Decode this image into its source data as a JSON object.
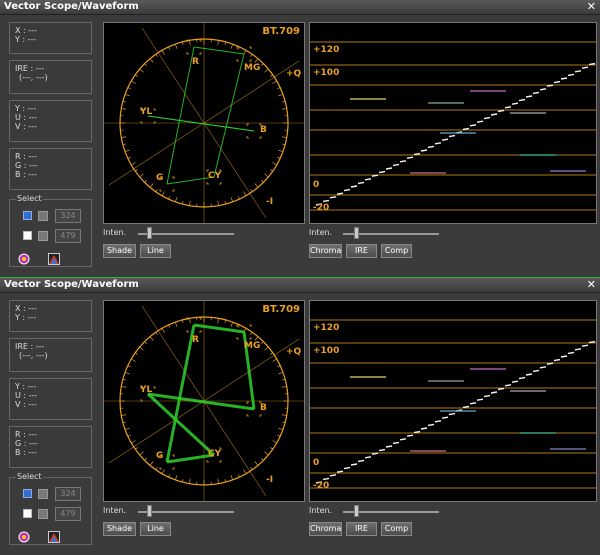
{
  "windows": [
    {
      "title": "Vector Scope/Waveform",
      "close_label": "✕",
      "info": {
        "xy": [
          "X : ---",
          "Y : ---"
        ],
        "ire": [
          "IRE : ---",
          "(---, ---)"
        ],
        "yuv": [
          "Y : ---",
          "U : ---",
          "V : ---"
        ],
        "rgb": [
          "R : ---",
          "G : ---",
          "B : ---"
        ]
      },
      "select": {
        "label": "Select",
        "row1_value": "324",
        "row2_value": "479"
      },
      "vectorscope": {
        "standard": "BT.709",
        "targets": {
          "R": "R",
          "MG": "MG",
          "Q": "+Q",
          "YL": "YL",
          "B": "B",
          "G": "G",
          "CY": "CY",
          "I": "-I"
        }
      },
      "waveform": {
        "labels": [
          "+120",
          "+100",
          "0",
          "-20"
        ]
      },
      "left_controls": {
        "inten": "Inten.",
        "buttons": [
          "Shade",
          "Line"
        ]
      },
      "right_controls": {
        "inten": "Inten.",
        "buttons": [
          "Chroma",
          "IRE",
          "Comp"
        ]
      }
    },
    {
      "title": "Vector Scope/Waveform",
      "close_label": "✕",
      "info": {
        "xy": [
          "X : ---",
          "Y : ---"
        ],
        "ire": [
          "IRE : ---",
          "(---, ---)"
        ],
        "yuv": [
          "Y : ---",
          "U : ---",
          "V : ---"
        ],
        "rgb": [
          "R : ---",
          "G : ---",
          "B : ---"
        ]
      },
      "select": {
        "label": "Select",
        "row1_value": "324",
        "row2_value": "479"
      },
      "vectorscope": {
        "standard": "BT.709",
        "targets": {
          "R": "R",
          "MG": "MG",
          "Q": "+Q",
          "YL": "YL",
          "B": "B",
          "G": "G",
          "CY": "CY",
          "I": "-I"
        }
      },
      "waveform": {
        "labels": [
          "+120",
          "+100",
          "0",
          "-20"
        ]
      },
      "left_controls": {
        "inten": "Inten.",
        "buttons": [
          "Shade",
          "Line"
        ]
      },
      "right_controls": {
        "inten": "Inten.",
        "buttons": [
          "Chroma",
          "IRE",
          "Comp"
        ]
      }
    }
  ],
  "colors": {
    "accent": "#e8a020",
    "trace": "#2fd02f",
    "divider": "#35b035"
  }
}
